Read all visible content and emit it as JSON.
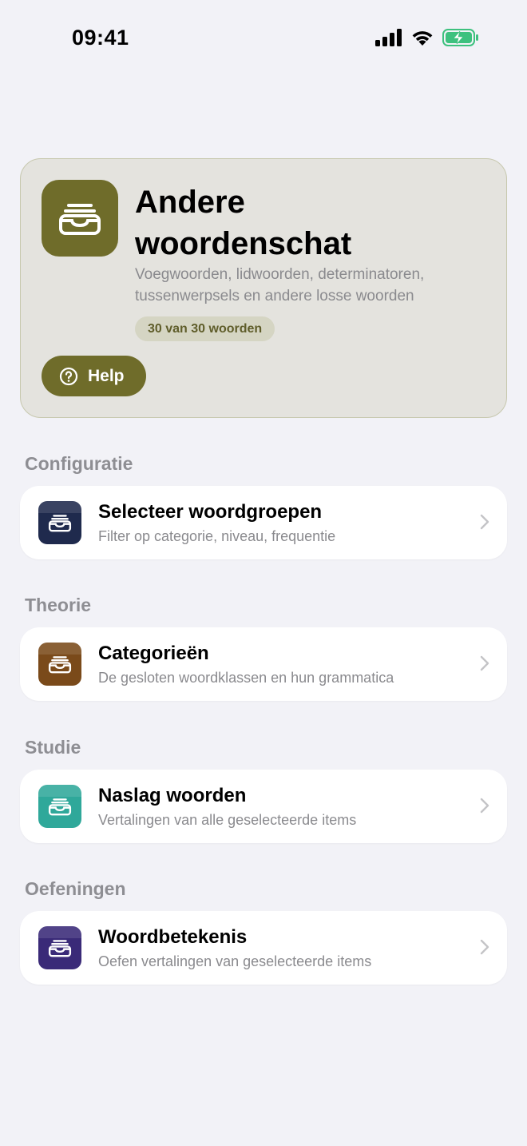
{
  "status_bar": {
    "time": "09:41"
  },
  "hero": {
    "icon": "tray-icon",
    "title": "Andere woordenschat",
    "description": "Voegwoorden, lidwoorden, determinatoren, tussenwerpsels en andere losse woorden",
    "badge": "30 van 30 woorden",
    "help_label": "Help",
    "accent_color": "#6F6C2A"
  },
  "sections": [
    {
      "header": "Configuratie",
      "item": {
        "title": "Selecteer woordgroepen",
        "subtitle": "Filter op categorie, niveau, frequentie",
        "icon": "tray-icon",
        "color": "#1F2A4D"
      }
    },
    {
      "header": "Theorie",
      "item": {
        "title": "Categorieën",
        "subtitle": "De gesloten woordklassen en hun grammatica",
        "icon": "tray-icon",
        "color": "#7A4A1A"
      }
    },
    {
      "header": "Studie",
      "item": {
        "title": "Naslag woorden",
        "subtitle": "Vertalingen van alle geselecteerde items",
        "icon": "tray-icon",
        "color": "#2FA89A"
      }
    },
    {
      "header": "Oefeningen",
      "item": {
        "title": "Woordbetekenis",
        "subtitle": "Oefen vertalingen van geselecteerde items",
        "icon": "tray-icon",
        "color": "#3A2A78"
      }
    }
  ]
}
